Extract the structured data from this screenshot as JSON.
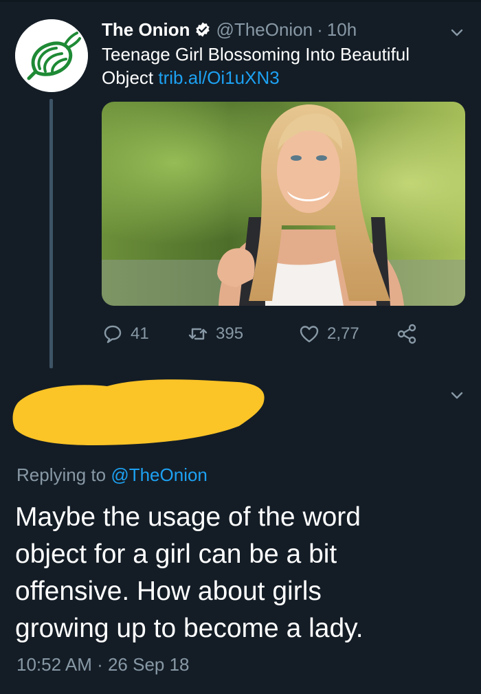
{
  "theme": {
    "background": "#141d26",
    "text_primary": "#ffffff",
    "text_secondary": "#8899a6",
    "link": "#1da1f2",
    "thread_line": "#3d5466",
    "redaction": "#fbc427",
    "onion_green": "#1e8a35"
  },
  "tweet": {
    "author_name": "The Onion",
    "verified": true,
    "handle": "@TheOnion",
    "separator": "·",
    "time_ago": "10h",
    "text": "Teenage Girl Blossoming Into Beautiful Object",
    "link": "trib.al/Oi1uXN3",
    "actions": {
      "replies": "41",
      "retweets": "395",
      "likes": "2,77"
    },
    "icons": [
      "onion-logo",
      "verified-badge-icon",
      "chevron-down-icon",
      "reply-icon",
      "retweet-icon",
      "like-icon",
      "share-icon"
    ]
  },
  "reply": {
    "replying_prefix": "Replying to",
    "replying_to": "@TheOnion",
    "lines": [
      "Maybe the usage of the word",
      "object for a girl can be a bit",
      "offensive. How about girls",
      "growing up to become a lady."
    ],
    "timestamp": "10:52 AM · 26 Sep 18"
  }
}
